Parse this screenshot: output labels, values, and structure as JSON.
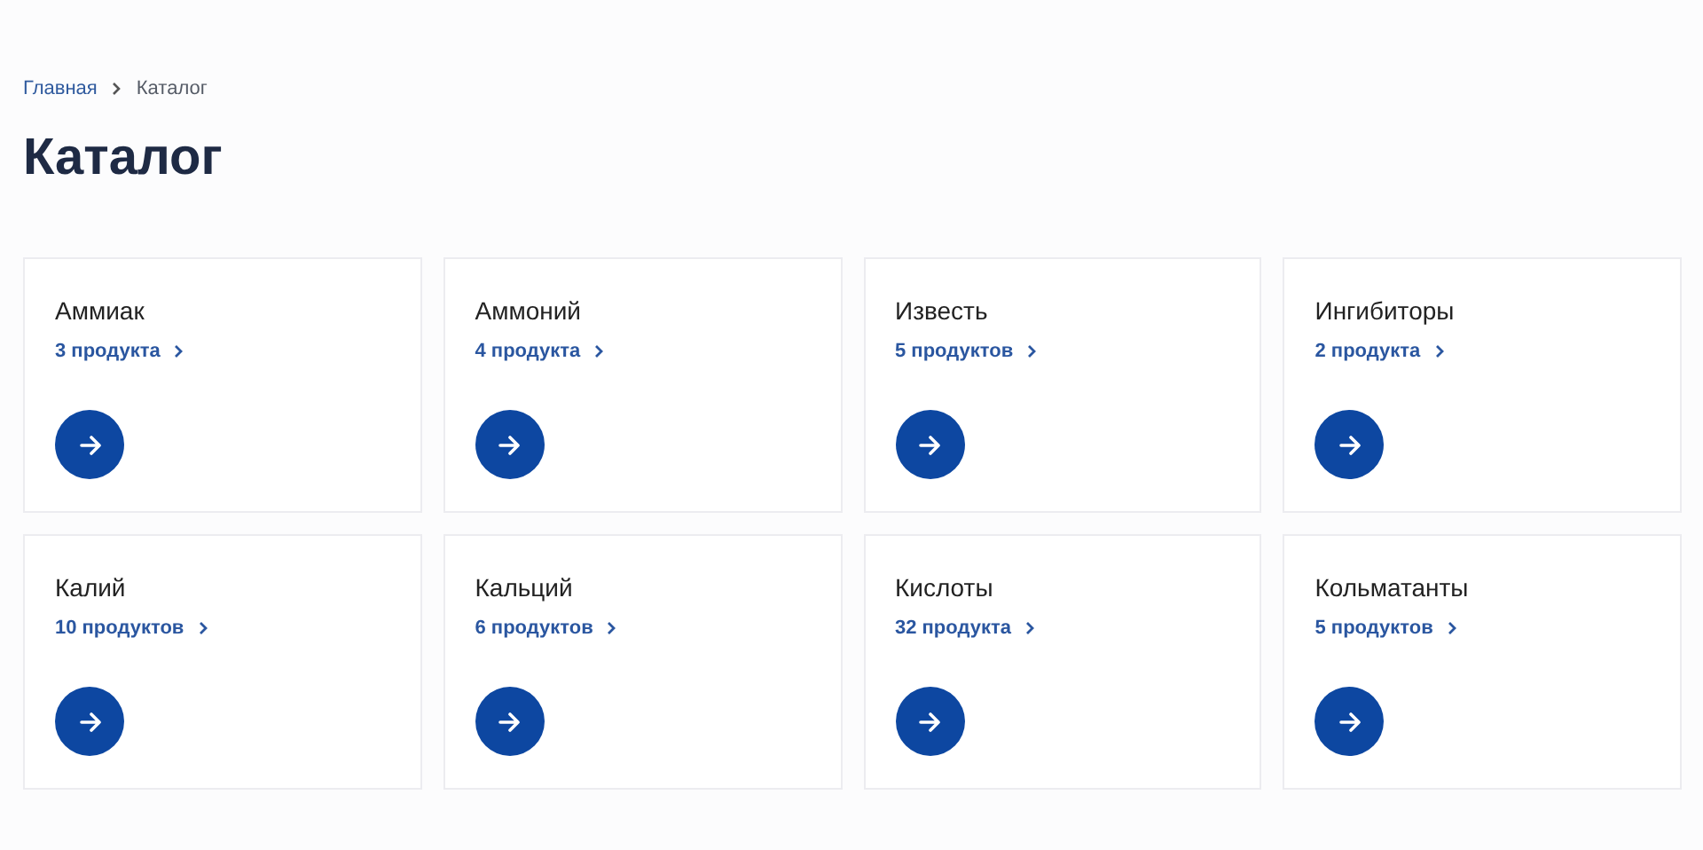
{
  "breadcrumbs": [
    {
      "label": "Главная",
      "current": false
    },
    {
      "label": "Каталог",
      "current": true
    }
  ],
  "title": "Каталог",
  "categories": [
    {
      "name": "Аммиак",
      "count": "3 продукта"
    },
    {
      "name": "Аммоний",
      "count": "4 продукта"
    },
    {
      "name": "Известь",
      "count": "5 продуктов"
    },
    {
      "name": "Ингибиторы",
      "count": "2 продукта"
    },
    {
      "name": "Калий",
      "count": "10 продуктов"
    },
    {
      "name": "Кальций",
      "count": "6 продуктов"
    },
    {
      "name": "Кислоты",
      "count": "32 продукта"
    },
    {
      "name": "Кольматанты",
      "count": "5 продуктов"
    }
  ]
}
